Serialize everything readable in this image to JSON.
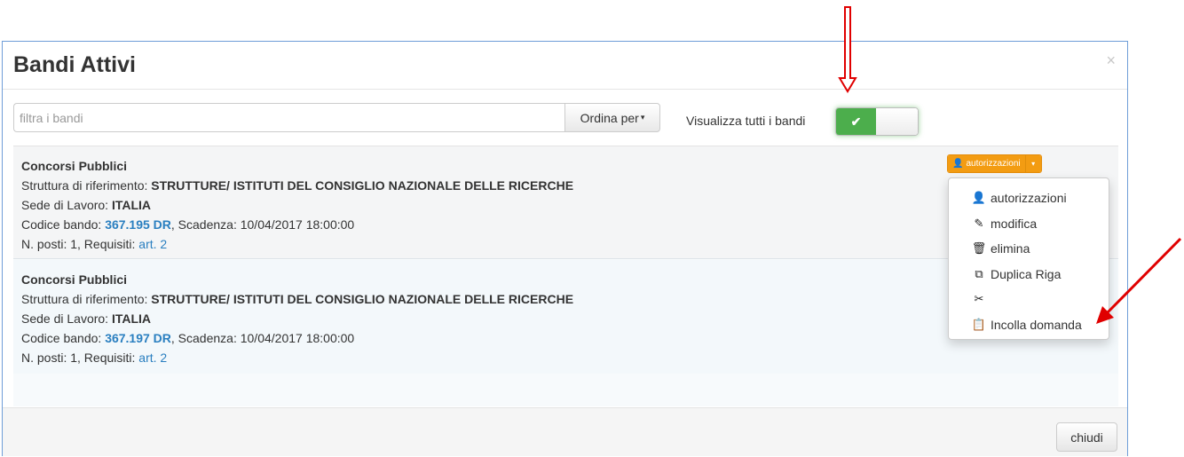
{
  "modal": {
    "title": "Bandi Attivi",
    "close_glyph": "×"
  },
  "toolbar": {
    "search_placeholder": "filtra i bandi",
    "search_value": "",
    "order_label": "Ordina per",
    "order_caret": "▾",
    "toggle_label": "Visualizza tutti i bandi",
    "toggle_on_glyph": "✔",
    "toggle_state": "on"
  },
  "items": [
    {
      "title": "Concorsi Pubblici",
      "struttura_label": "Struttura di riferimento: ",
      "struttura_value": "STRUTTURE/ ISTITUTI DEL CONSIGLIO NAZIONALE DELLE RICERCHE",
      "sede_label": "Sede di Lavoro: ",
      "sede_value": "ITALIA",
      "codice_label": "Codice bando: ",
      "codice_value": "367.195 DR",
      "scadenza_label": ", Scadenza: ",
      "scadenza_value": "10/04/2017 18:00:00",
      "posti_label": "N. posti: 1, Requisiti: ",
      "requisiti_link": "art. 2"
    },
    {
      "title": "Concorsi Pubblici",
      "struttura_label": "Struttura di riferimento: ",
      "struttura_value": "STRUTTURE/ ISTITUTI DEL CONSIGLIO NAZIONALE DELLE RICERCHE",
      "sede_label": "Sede di Lavoro: ",
      "sede_value": "ITALIA",
      "codice_label": "Codice bando: ",
      "codice_value": "367.197 DR",
      "scadenza_label": ", Scadenza: ",
      "scadenza_value": "10/04/2017 18:00:00",
      "posti_label": "N. posti: 1, Requisiti: ",
      "requisiti_link": "art. 2"
    }
  ],
  "action_button": {
    "label": "autorizzazioni",
    "icon": "user-icon",
    "caret": "▾",
    "color": "#f39c12"
  },
  "dropdown": [
    {
      "label": "autorizzazioni",
      "icon": "user-icon",
      "glyph": "👤"
    },
    {
      "label": "modifica",
      "icon": "pencil-icon",
      "glyph": "✎"
    },
    {
      "label": "elimina",
      "icon": "trash-icon",
      "glyph": "🗑"
    },
    {
      "label": "Duplica Riga",
      "icon": "copy-icon",
      "glyph": "⧉"
    },
    {
      "label": "",
      "icon": "scissors-icon",
      "glyph": "✂"
    },
    {
      "label": "Incolla domanda",
      "icon": "paste-icon",
      "glyph": "📋"
    }
  ],
  "footer": {
    "close_label": "chiudi"
  },
  "colors": {
    "accent_blue": "#2a7fc0",
    "toggle_green": "#4cae4c",
    "annotation_red": "#e00000"
  }
}
